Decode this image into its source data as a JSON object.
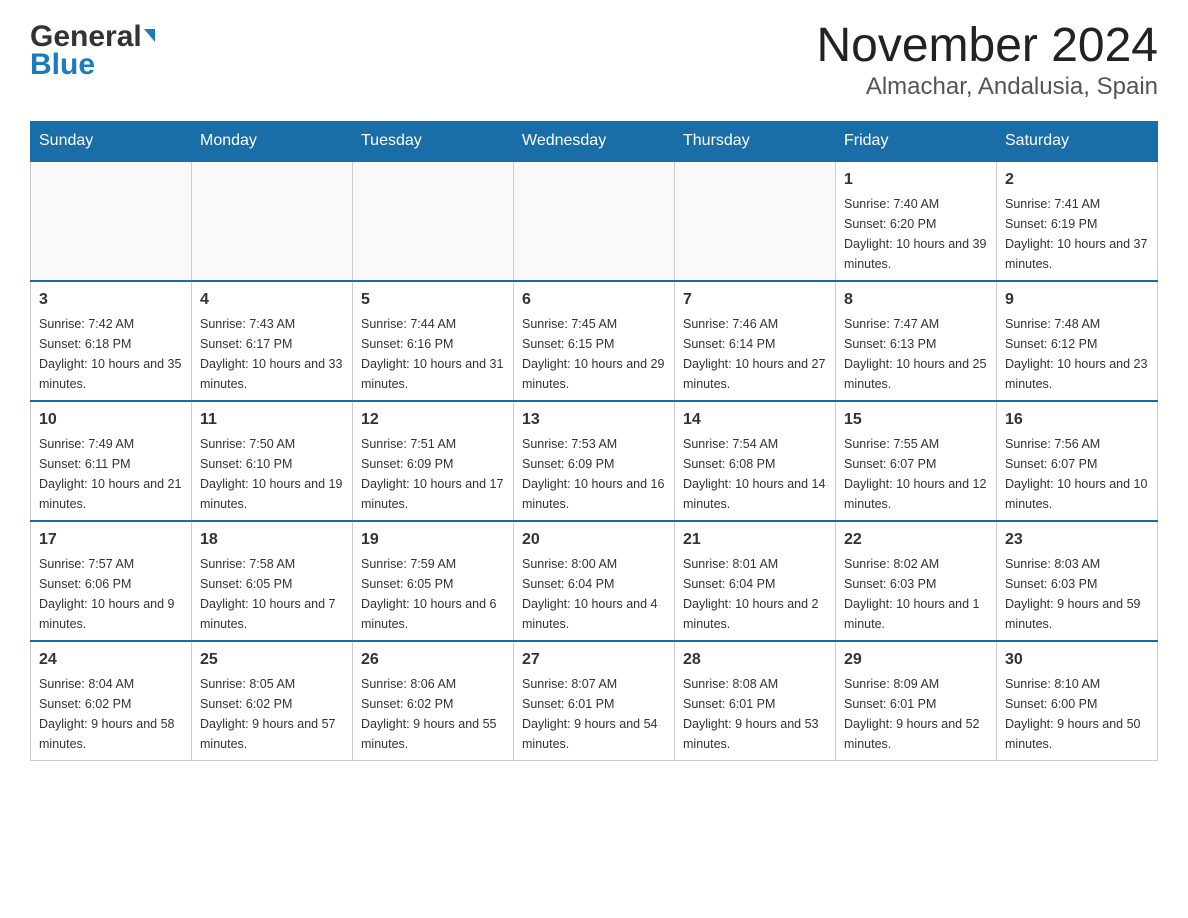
{
  "logo": {
    "general": "General",
    "blue": "Blue",
    "arrow": "▶"
  },
  "title": "November 2024",
  "subtitle": "Almachar, Andalusia, Spain",
  "days_of_week": [
    "Sunday",
    "Monday",
    "Tuesday",
    "Wednesday",
    "Thursday",
    "Friday",
    "Saturday"
  ],
  "weeks": [
    [
      {
        "day": "",
        "sunrise": "",
        "sunset": "",
        "daylight": ""
      },
      {
        "day": "",
        "sunrise": "",
        "sunset": "",
        "daylight": ""
      },
      {
        "day": "",
        "sunrise": "",
        "sunset": "",
        "daylight": ""
      },
      {
        "day": "",
        "sunrise": "",
        "sunset": "",
        "daylight": ""
      },
      {
        "day": "",
        "sunrise": "",
        "sunset": "",
        "daylight": ""
      },
      {
        "day": "1",
        "sunrise": "Sunrise: 7:40 AM",
        "sunset": "Sunset: 6:20 PM",
        "daylight": "Daylight: 10 hours and 39 minutes."
      },
      {
        "day": "2",
        "sunrise": "Sunrise: 7:41 AM",
        "sunset": "Sunset: 6:19 PM",
        "daylight": "Daylight: 10 hours and 37 minutes."
      }
    ],
    [
      {
        "day": "3",
        "sunrise": "Sunrise: 7:42 AM",
        "sunset": "Sunset: 6:18 PM",
        "daylight": "Daylight: 10 hours and 35 minutes."
      },
      {
        "day": "4",
        "sunrise": "Sunrise: 7:43 AM",
        "sunset": "Sunset: 6:17 PM",
        "daylight": "Daylight: 10 hours and 33 minutes."
      },
      {
        "day": "5",
        "sunrise": "Sunrise: 7:44 AM",
        "sunset": "Sunset: 6:16 PM",
        "daylight": "Daylight: 10 hours and 31 minutes."
      },
      {
        "day": "6",
        "sunrise": "Sunrise: 7:45 AM",
        "sunset": "Sunset: 6:15 PM",
        "daylight": "Daylight: 10 hours and 29 minutes."
      },
      {
        "day": "7",
        "sunrise": "Sunrise: 7:46 AM",
        "sunset": "Sunset: 6:14 PM",
        "daylight": "Daylight: 10 hours and 27 minutes."
      },
      {
        "day": "8",
        "sunrise": "Sunrise: 7:47 AM",
        "sunset": "Sunset: 6:13 PM",
        "daylight": "Daylight: 10 hours and 25 minutes."
      },
      {
        "day": "9",
        "sunrise": "Sunrise: 7:48 AM",
        "sunset": "Sunset: 6:12 PM",
        "daylight": "Daylight: 10 hours and 23 minutes."
      }
    ],
    [
      {
        "day": "10",
        "sunrise": "Sunrise: 7:49 AM",
        "sunset": "Sunset: 6:11 PM",
        "daylight": "Daylight: 10 hours and 21 minutes."
      },
      {
        "day": "11",
        "sunrise": "Sunrise: 7:50 AM",
        "sunset": "Sunset: 6:10 PM",
        "daylight": "Daylight: 10 hours and 19 minutes."
      },
      {
        "day": "12",
        "sunrise": "Sunrise: 7:51 AM",
        "sunset": "Sunset: 6:09 PM",
        "daylight": "Daylight: 10 hours and 17 minutes."
      },
      {
        "day": "13",
        "sunrise": "Sunrise: 7:53 AM",
        "sunset": "Sunset: 6:09 PM",
        "daylight": "Daylight: 10 hours and 16 minutes."
      },
      {
        "day": "14",
        "sunrise": "Sunrise: 7:54 AM",
        "sunset": "Sunset: 6:08 PM",
        "daylight": "Daylight: 10 hours and 14 minutes."
      },
      {
        "day": "15",
        "sunrise": "Sunrise: 7:55 AM",
        "sunset": "Sunset: 6:07 PM",
        "daylight": "Daylight: 10 hours and 12 minutes."
      },
      {
        "day": "16",
        "sunrise": "Sunrise: 7:56 AM",
        "sunset": "Sunset: 6:07 PM",
        "daylight": "Daylight: 10 hours and 10 minutes."
      }
    ],
    [
      {
        "day": "17",
        "sunrise": "Sunrise: 7:57 AM",
        "sunset": "Sunset: 6:06 PM",
        "daylight": "Daylight: 10 hours and 9 minutes."
      },
      {
        "day": "18",
        "sunrise": "Sunrise: 7:58 AM",
        "sunset": "Sunset: 6:05 PM",
        "daylight": "Daylight: 10 hours and 7 minutes."
      },
      {
        "day": "19",
        "sunrise": "Sunrise: 7:59 AM",
        "sunset": "Sunset: 6:05 PM",
        "daylight": "Daylight: 10 hours and 6 minutes."
      },
      {
        "day": "20",
        "sunrise": "Sunrise: 8:00 AM",
        "sunset": "Sunset: 6:04 PM",
        "daylight": "Daylight: 10 hours and 4 minutes."
      },
      {
        "day": "21",
        "sunrise": "Sunrise: 8:01 AM",
        "sunset": "Sunset: 6:04 PM",
        "daylight": "Daylight: 10 hours and 2 minutes."
      },
      {
        "day": "22",
        "sunrise": "Sunrise: 8:02 AM",
        "sunset": "Sunset: 6:03 PM",
        "daylight": "Daylight: 10 hours and 1 minute."
      },
      {
        "day": "23",
        "sunrise": "Sunrise: 8:03 AM",
        "sunset": "Sunset: 6:03 PM",
        "daylight": "Daylight: 9 hours and 59 minutes."
      }
    ],
    [
      {
        "day": "24",
        "sunrise": "Sunrise: 8:04 AM",
        "sunset": "Sunset: 6:02 PM",
        "daylight": "Daylight: 9 hours and 58 minutes."
      },
      {
        "day": "25",
        "sunrise": "Sunrise: 8:05 AM",
        "sunset": "Sunset: 6:02 PM",
        "daylight": "Daylight: 9 hours and 57 minutes."
      },
      {
        "day": "26",
        "sunrise": "Sunrise: 8:06 AM",
        "sunset": "Sunset: 6:02 PM",
        "daylight": "Daylight: 9 hours and 55 minutes."
      },
      {
        "day": "27",
        "sunrise": "Sunrise: 8:07 AM",
        "sunset": "Sunset: 6:01 PM",
        "daylight": "Daylight: 9 hours and 54 minutes."
      },
      {
        "day": "28",
        "sunrise": "Sunrise: 8:08 AM",
        "sunset": "Sunset: 6:01 PM",
        "daylight": "Daylight: 9 hours and 53 minutes."
      },
      {
        "day": "29",
        "sunrise": "Sunrise: 8:09 AM",
        "sunset": "Sunset: 6:01 PM",
        "daylight": "Daylight: 9 hours and 52 minutes."
      },
      {
        "day": "30",
        "sunrise": "Sunrise: 8:10 AM",
        "sunset": "Sunset: 6:00 PM",
        "daylight": "Daylight: 9 hours and 50 minutes."
      }
    ]
  ]
}
